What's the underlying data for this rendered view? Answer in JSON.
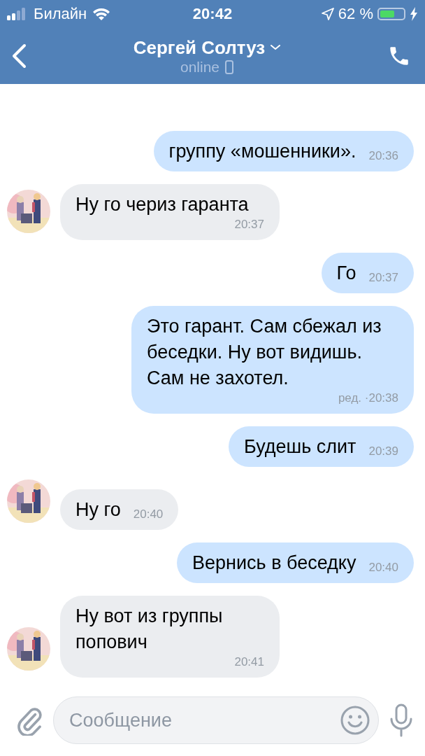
{
  "status_bar": {
    "carrier": "Билайн",
    "time": "20:42",
    "battery": "62 %"
  },
  "header": {
    "title": "Сергей Солтуз",
    "status": "online"
  },
  "messages": [
    {
      "kind": "outgoing",
      "text": "группу «мошенники».",
      "time": "20:36"
    },
    {
      "kind": "incoming",
      "text": "Ну го чериз гаранта",
      "time": "20:37"
    },
    {
      "kind": "outgoing",
      "text": "Го",
      "time": "20:37"
    },
    {
      "kind": "outgoing",
      "text": "Это гарант. Сам сбежал из беседки. Ну вот видишь. Сам не захотел.",
      "edited": "ред. ·",
      "time": "20:38"
    },
    {
      "kind": "outgoing",
      "text": "Будешь слит",
      "time": "20:39"
    },
    {
      "kind": "incoming",
      "text": "Ну го",
      "time": "20:40"
    },
    {
      "kind": "outgoing",
      "text": "Вернись в беседку",
      "time": "20:40"
    },
    {
      "kind": "incoming",
      "text": "Ну вот из группы попович",
      "time": "20:41"
    }
  ],
  "composer": {
    "placeholder": "Сообщение"
  }
}
